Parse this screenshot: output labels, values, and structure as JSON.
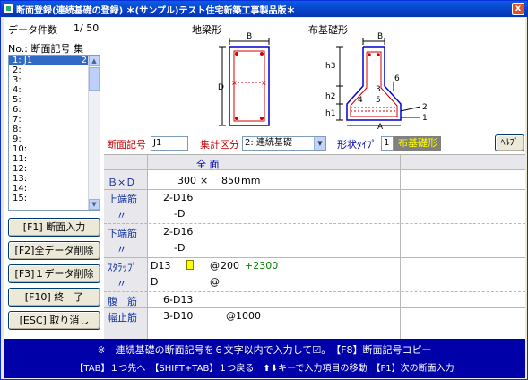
{
  "window": {
    "title": "断面登録(連続基礎の登録) ＊(サンプル)テスト住宅新築工事製品版＊",
    "close_glyph": "x"
  },
  "left_panel": {
    "count_label": "データ件数",
    "count_value": "1/ 50",
    "list_header": "No.: 断面記号 集",
    "list_items": [
      {
        "label": "1: J1",
        "count": "2",
        "selected": true
      },
      {
        "label": "2:"
      },
      {
        "label": "3:"
      },
      {
        "label": "4:"
      },
      {
        "label": "5:"
      },
      {
        "label": "6:"
      },
      {
        "label": "7:"
      },
      {
        "label": "8:"
      },
      {
        "label": "9:"
      },
      {
        "label": "10:"
      },
      {
        "label": "11:"
      },
      {
        "label": "12:"
      },
      {
        "label": "13:"
      },
      {
        "label": "14:"
      },
      {
        "label": "15:"
      }
    ],
    "buttons": {
      "f1": "[F1] 断面入力",
      "f2": "[F2]全データ削除",
      "f3": "[F3]１データ削除",
      "f10": "[F10] 終　了",
      "esc": "[ESC] 取り消し"
    }
  },
  "diagrams": {
    "beam": {
      "title": "地梁形",
      "label_b": "B",
      "label_d": "D"
    },
    "footing": {
      "title": "布基礎形",
      "label_b": "B",
      "label_a": "A",
      "h3": "h3",
      "h2": "h2",
      "h1": "h1",
      "n1": "1",
      "n2": "2",
      "n3": "3",
      "n4": "4",
      "n5": "5",
      "n6": "6"
    }
  },
  "form": {
    "section_label": "断面記号",
    "section_value": "J1",
    "category_label": "集計区分",
    "category_value": "2: 連続基礎",
    "shape_type_label": "形状ﾀｲﾌﾟ",
    "shape_type_value": "1",
    "shape_name": "布基礎形",
    "help_label": "ﾍﾙﾌﾟ"
  },
  "grid": {
    "column_header": "全 面",
    "rows": {
      "bxd": {
        "label": "Ｂ×Ｄ",
        "b": "300",
        "times": "×",
        "d": "850",
        "unit": "mm"
      },
      "top": {
        "label": "上端筋",
        "v1": "2-D16",
        "sub_label": "〃",
        "v2": "-D"
      },
      "bottom": {
        "label": "下端筋",
        "v1": "2-D16",
        "sub_label": "〃",
        "v2": "-D"
      },
      "stirrup": {
        "label": "ｽﾀﾗｯﾌﾟ",
        "bar": "D13",
        "at": "@",
        "pitch": "200",
        "extra": "+2300",
        "sub_label": "〃",
        "bar2": "D",
        "at2": "@"
      },
      "web": {
        "label": "腹　筋",
        "value": "6-D13"
      },
      "width_stop": {
        "label": "幅止筋",
        "value": "3-D10",
        "pitch": "@1000"
      }
    }
  },
  "status": {
    "line1": "※　連続基礎の断面記号を６文字以内で入力して☑。　【F8】断面記号コピー",
    "line2": "【TAB】１つ先へ　【SHIFT+TAB】１つ戻る　⬆⬇キーで入力項目の移動　【F1】次の断面入力"
  },
  "colors": {
    "titlebar": "#0a5ce6",
    "selection": "#316ac5",
    "status_bg": "#0000a8",
    "shape_btn_bg": "#808080",
    "shape_btn_text": "#ffff00",
    "label_red": "#c00000",
    "rebar": "#d00000",
    "outline": "#0000d0",
    "extra_green": "#008000"
  }
}
